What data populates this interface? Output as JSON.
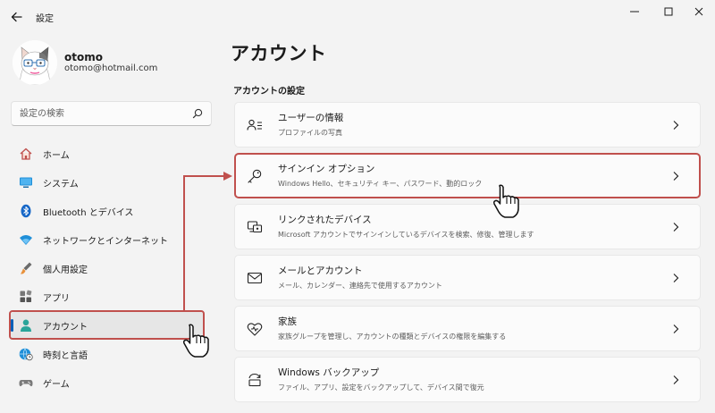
{
  "window": {
    "title": "設定",
    "back_label": "←",
    "minimize_label": "—",
    "maximize_label": "☐",
    "close_label": "✕"
  },
  "profile": {
    "name": "otomo",
    "email": "otomo@hotmail.com"
  },
  "search": {
    "placeholder": "設定の検索",
    "value": ""
  },
  "sidebar": {
    "items": [
      {
        "label": "ホーム",
        "icon": "home-icon",
        "active": false
      },
      {
        "label": "システム",
        "icon": "monitor-icon",
        "active": false
      },
      {
        "label": "Bluetooth とデバイス",
        "icon": "bluetooth-icon",
        "active": false
      },
      {
        "label": "ネットワークとインターネット",
        "icon": "wifi-icon",
        "active": false
      },
      {
        "label": "個人用設定",
        "icon": "brush-icon",
        "active": false
      },
      {
        "label": "アプリ",
        "icon": "apps-icon",
        "active": false
      },
      {
        "label": "アカウント",
        "icon": "person-icon",
        "active": true
      },
      {
        "label": "時刻と言語",
        "icon": "globe-clock-icon",
        "active": false
      },
      {
        "label": "ゲーム",
        "icon": "gamepad-icon",
        "active": false
      }
    ]
  },
  "main": {
    "title": "アカウント",
    "section_title": "アカウントの設定",
    "cards": [
      {
        "title": "ユーザーの情報",
        "desc": "プロファイルの写真",
        "icon": "user-info-icon"
      },
      {
        "title": "サインイン オプション",
        "desc": "Windows Hello、セキュリティ キー、パスワード、動的ロック",
        "icon": "key-icon"
      },
      {
        "title": "リンクされたデバイス",
        "desc": "Microsoft アカウントでサインインしているデバイスを検索、修復、管理します",
        "icon": "linked-devices-icon"
      },
      {
        "title": "メールとアカウント",
        "desc": "メール、カレンダー、連絡先で使用するアカウント",
        "icon": "mail-icon"
      },
      {
        "title": "家族",
        "desc": "家族グループを管理し、アカウントの種類とデバイスの権限を編集する",
        "icon": "family-heart-icon"
      },
      {
        "title": "Windows バックアップ",
        "desc": "ファイル、アプリ、設定をバックアップして、デバイス間で復元",
        "icon": "backup-icon"
      }
    ]
  },
  "colors": {
    "accent": "#005fb8",
    "highlight": "#c0504d",
    "background": "#f3f3f3",
    "card": "#fbfbfb"
  }
}
